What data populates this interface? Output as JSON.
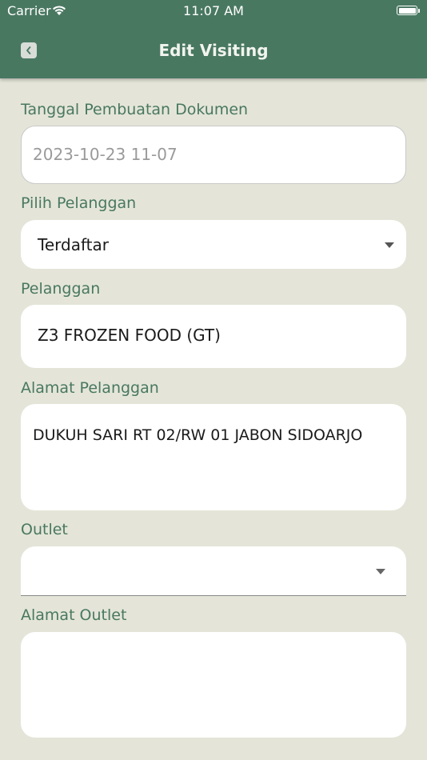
{
  "status_bar": {
    "carrier": "Carrier",
    "time": "11:07 AM"
  },
  "header": {
    "title": "Edit Visiting"
  },
  "form": {
    "tanggal": {
      "label": "Tanggal Pembuatan Dokumen",
      "value": "2023-10-23 11-07"
    },
    "pilih_pelanggan": {
      "label": "Pilih Pelanggan",
      "value": "Terdaftar"
    },
    "pelanggan": {
      "label": "Pelanggan",
      "value": "Z3 FROZEN FOOD (GT)"
    },
    "alamat_pelanggan": {
      "label": "Alamat Pelanggan",
      "value": "DUKUH SARI RT 02/RW 01 JABON SIDOARJO"
    },
    "outlet": {
      "label": "Outlet",
      "value": ""
    },
    "alamat_outlet": {
      "label": "Alamat Outlet",
      "value": ""
    }
  },
  "icons": {
    "back": "chevron-left-icon",
    "wifi": "wifi-icon",
    "battery": "battery-icon",
    "dropdown": "caret-down-icon"
  },
  "colors": {
    "header": "#497861",
    "background": "#e4e5d8",
    "label": "#497861"
  }
}
